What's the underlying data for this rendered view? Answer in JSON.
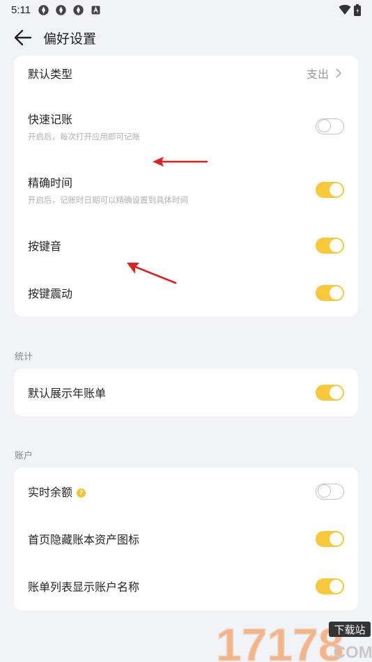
{
  "status": {
    "time": "5:11"
  },
  "header": {
    "title": "偏好设置"
  },
  "general": {
    "default_type": {
      "label": "默认类型",
      "value": "支出"
    },
    "quick_entry": {
      "label": "快速记账",
      "desc": "开启后，每次打开应用即可记账",
      "on": false
    },
    "precise_time": {
      "label": "精确时间",
      "desc": "开启后，记账时日期可以精确设置到具体时间",
      "on": true
    },
    "key_sound": {
      "label": "按键音",
      "on": true
    },
    "key_vibrate": {
      "label": "按键震动",
      "on": true
    }
  },
  "stats": {
    "section_title": "统计",
    "annual_bill": {
      "label": "默认展示年账单",
      "on": true
    }
  },
  "account": {
    "section_title": "账户",
    "realtime_balance": {
      "label": "实时余额",
      "on": false
    },
    "hide_asset_icon": {
      "label": "首页隐藏账本资产图标",
      "on": true
    },
    "show_account_name": {
      "label": "账单列表显示账户名称",
      "on": true
    }
  },
  "colors": {
    "accent": "#f7c73c",
    "background": "#f2f3f7",
    "card": "#ffffff"
  },
  "watermark": {
    "text": "17178",
    "badge": "下载站",
    "domain": ".COM"
  }
}
